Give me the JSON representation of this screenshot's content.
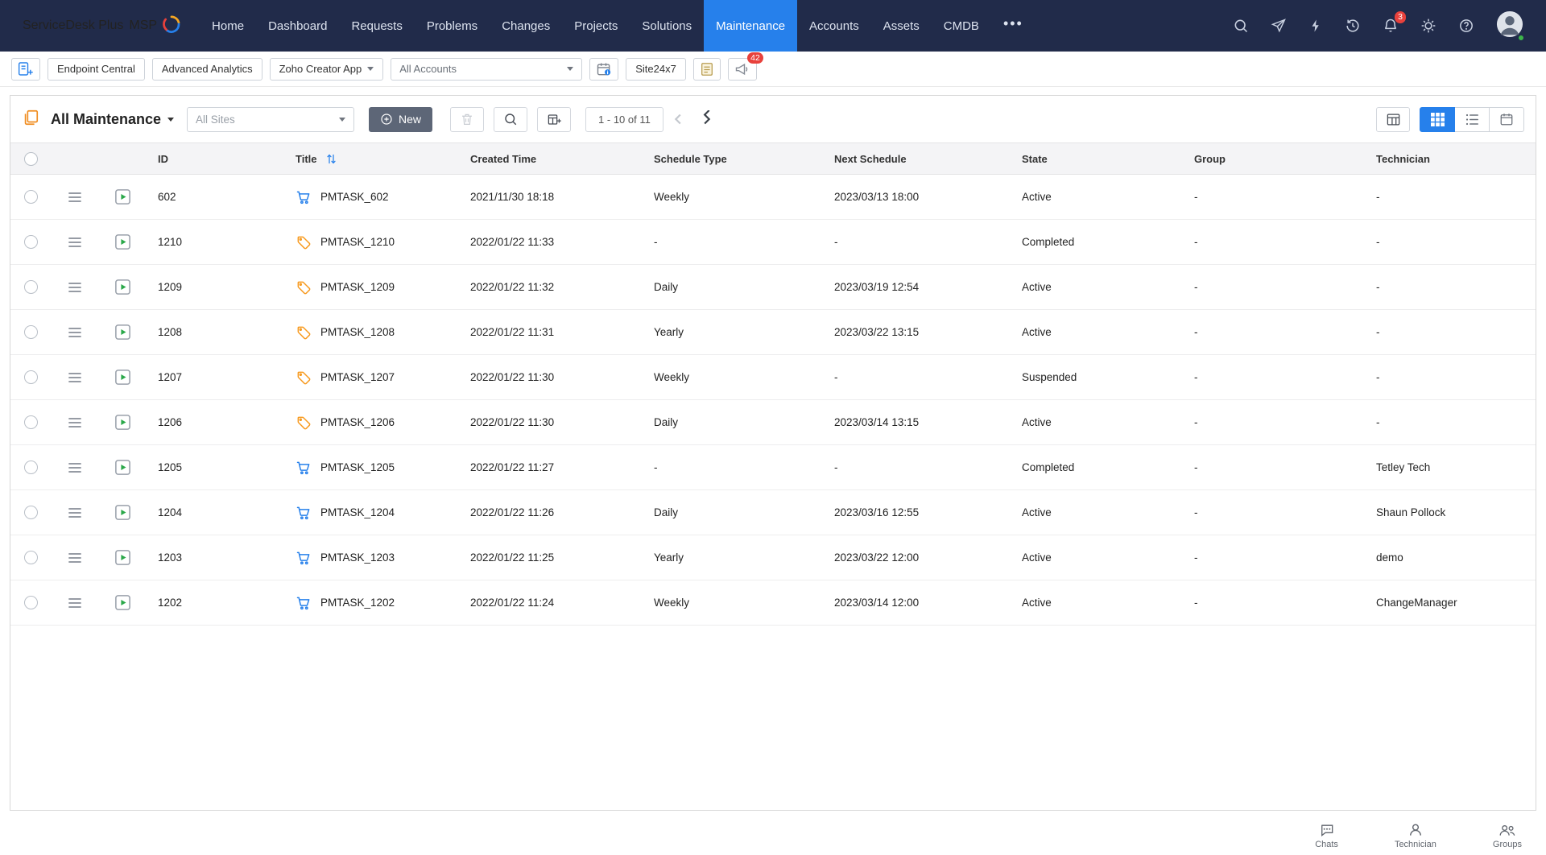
{
  "brand": {
    "name_main": "ServiceDesk Plus",
    "name_suffix": "MSP"
  },
  "nav": {
    "items": [
      "Home",
      "Dashboard",
      "Requests",
      "Problems",
      "Changes",
      "Projects",
      "Solutions",
      "Maintenance",
      "Accounts",
      "Assets",
      "CMDB"
    ],
    "active_index": 7,
    "more": "•••"
  },
  "topbar": {
    "bell_badge": "3"
  },
  "toolbar": {
    "buttons": [
      {
        "label": "Endpoint Central",
        "caret": false
      },
      {
        "label": "Advanced Analytics",
        "caret": false
      },
      {
        "label": "Zoho Creator App",
        "caret": true
      }
    ],
    "accounts_select": "All Accounts",
    "site_button": "Site24x7",
    "announce_badge": "42"
  },
  "view_header": {
    "title": "All Maintenance",
    "sites_select": "All Sites",
    "new_button": "New",
    "pagination": "1 - 10 of 11"
  },
  "table": {
    "columns": [
      "ID",
      "Title",
      "Created Time",
      "Schedule Type",
      "Next Schedule",
      "State",
      "Group",
      "Technician"
    ],
    "rows": [
      {
        "id": "602",
        "icon": "cart",
        "title": "PMTASK_602",
        "created": "2021/11/30 18:18",
        "schedule_type": "Weekly",
        "next_schedule": "2023/03/13 18:00",
        "state": "Active",
        "group": "-",
        "technician": "-"
      },
      {
        "id": "1210",
        "icon": "tag",
        "title": "PMTASK_1210",
        "created": "2022/01/22 11:33",
        "schedule_type": "-",
        "next_schedule": "-",
        "state": "Completed",
        "group": "-",
        "technician": "-"
      },
      {
        "id": "1209",
        "icon": "tag",
        "title": "PMTASK_1209",
        "created": "2022/01/22 11:32",
        "schedule_type": "Daily",
        "next_schedule": "2023/03/19 12:54",
        "state": "Active",
        "group": "-",
        "technician": "-"
      },
      {
        "id": "1208",
        "icon": "tag",
        "title": "PMTASK_1208",
        "created": "2022/01/22 11:31",
        "schedule_type": "Yearly",
        "next_schedule": "2023/03/22 13:15",
        "state": "Active",
        "group": "-",
        "technician": "-"
      },
      {
        "id": "1207",
        "icon": "tag",
        "title": "PMTASK_1207",
        "created": "2022/01/22 11:30",
        "schedule_type": "Weekly",
        "next_schedule": "-",
        "state": "Suspended",
        "group": "-",
        "technician": "-"
      },
      {
        "id": "1206",
        "icon": "tag",
        "title": "PMTASK_1206",
        "created": "2022/01/22 11:30",
        "schedule_type": "Daily",
        "next_schedule": "2023/03/14 13:15",
        "state": "Active",
        "group": "-",
        "technician": "-"
      },
      {
        "id": "1205",
        "icon": "cart",
        "title": "PMTASK_1205",
        "created": "2022/01/22 11:27",
        "schedule_type": "-",
        "next_schedule": "-",
        "state": "Completed",
        "group": "-",
        "technician": "Tetley Tech"
      },
      {
        "id": "1204",
        "icon": "cart",
        "title": "PMTASK_1204",
        "created": "2022/01/22 11:26",
        "schedule_type": "Daily",
        "next_schedule": "2023/03/16 12:55",
        "state": "Active",
        "group": "-",
        "technician": "Shaun Pollock"
      },
      {
        "id": "1203",
        "icon": "cart",
        "title": "PMTASK_1203",
        "created": "2022/01/22 11:25",
        "schedule_type": "Yearly",
        "next_schedule": "2023/03/22 12:00",
        "state": "Active",
        "group": "-",
        "technician": "demo"
      },
      {
        "id": "1202",
        "icon": "cart",
        "title": "PMTASK_1202",
        "created": "2022/01/22 11:24",
        "schedule_type": "Weekly",
        "next_schedule": "2023/03/14 12:00",
        "state": "Active",
        "group": "-",
        "technician": "ChangeManager"
      }
    ]
  },
  "footer": {
    "items": [
      "Chats",
      "Technician",
      "Groups"
    ]
  },
  "colors": {
    "accent": "#2680eb",
    "navy": "#212b4a",
    "badge_red": "#e8413c",
    "orange": "#f08c1e",
    "green": "#2ba84a"
  }
}
